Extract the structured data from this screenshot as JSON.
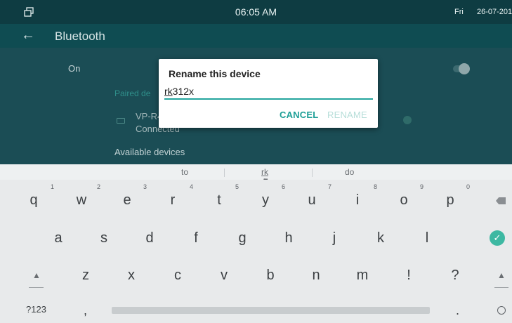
{
  "status_bar": {
    "time": "06:05 AM",
    "day": "Fri",
    "date": "26-07-201",
    "window_icon": "multi-window-icon"
  },
  "app_bar": {
    "back_icon": "arrow-left-icon",
    "back_glyph": "←",
    "title": "Bluetooth"
  },
  "settings": {
    "toggle_label": "On",
    "paired_header": "Paired de",
    "device_name": "VP-R4",
    "device_status": "Connected",
    "available_header": "Available devices"
  },
  "dialog": {
    "title": "Rename this device",
    "input_prefix": "rk",
    "input_rest": "312x",
    "cancel_label": "CANCEL",
    "rename_label": "RENAME",
    "accent_color": "#1c9e96"
  },
  "suggestions": [
    "to",
    "rk",
    "do"
  ],
  "suggestion_dots": "•••",
  "keyboard": {
    "row1": [
      "q",
      "w",
      "e",
      "r",
      "t",
      "y",
      "u",
      "i",
      "o",
      "p"
    ],
    "row1_hints": [
      "1",
      "2",
      "3",
      "4",
      "5",
      "6",
      "7",
      "8",
      "9",
      "0"
    ],
    "row2": [
      "a",
      "s",
      "d",
      "f",
      "g",
      "h",
      "j",
      "k",
      "l"
    ],
    "row3": [
      "z",
      "x",
      "c",
      "v",
      "b",
      "n",
      "m",
      "!",
      "?"
    ],
    "symbols_label": "?123",
    "comma": ",",
    "period": ".",
    "shift_glyph": "▲",
    "enter_glyph": "✓",
    "backspace_icon": "backspace-icon",
    "enter_icon": "enter-check-icon",
    "emoji_icon": "emoji-icon"
  }
}
